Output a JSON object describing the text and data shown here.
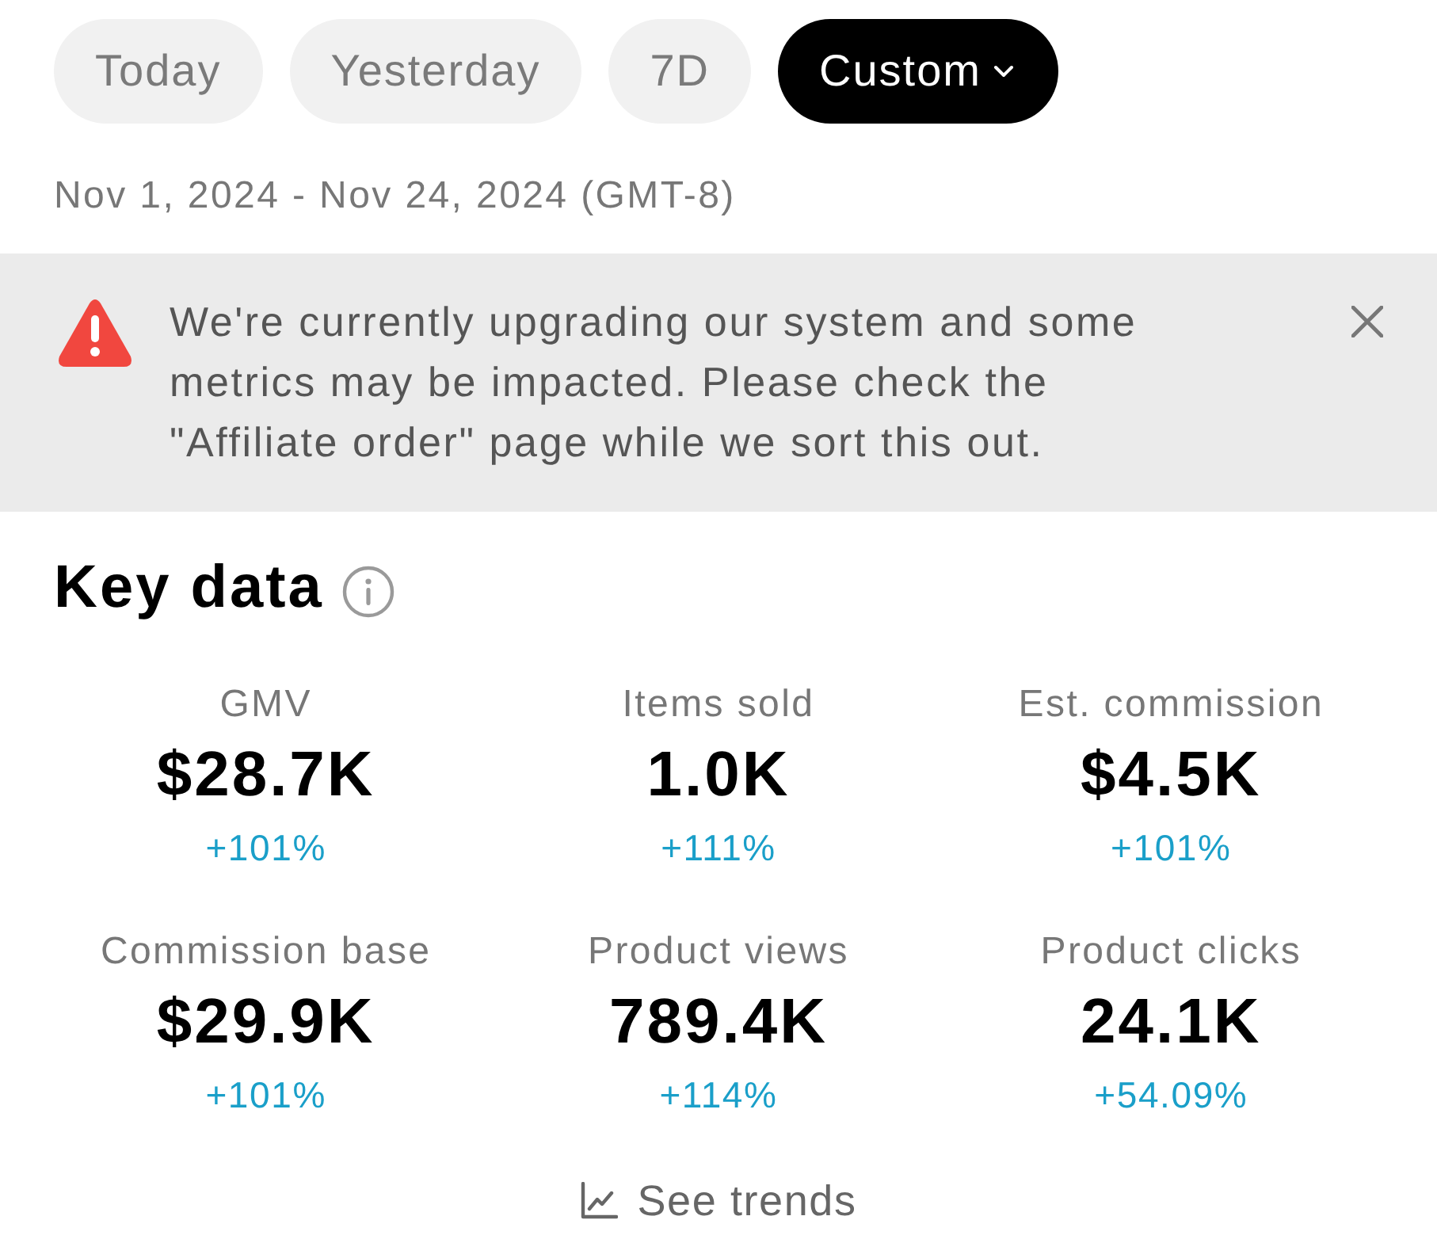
{
  "date_tabs": [
    {
      "label": "Today",
      "selected": false,
      "has_menu": false
    },
    {
      "label": "Yesterday",
      "selected": false,
      "has_menu": false
    },
    {
      "label": "7D",
      "selected": false,
      "has_menu": false
    },
    {
      "label": "Custom",
      "selected": true,
      "has_menu": true
    }
  ],
  "date_range": "Nov 1, 2024 - Nov 24, 2024 (GMT-8)",
  "alert": {
    "message": "We're currently upgrading our system and some metrics may be impacted. Please check the \"Affiliate order\" page while we sort this out."
  },
  "key_data": {
    "title": "Key data",
    "metrics": [
      {
        "label": "GMV",
        "value": "$28.7K",
        "change": "+101%"
      },
      {
        "label": "Items sold",
        "value": "1.0K",
        "change": "+111%"
      },
      {
        "label": "Est. commission",
        "value": "$4.5K",
        "change": "+101%"
      },
      {
        "label": "Commission base",
        "value": "$29.9K",
        "change": "+101%"
      },
      {
        "label": "Product views",
        "value": "789.4K",
        "change": "+114%"
      },
      {
        "label": "Product clicks",
        "value": "24.1K",
        "change": "+54.09%"
      }
    ]
  },
  "see_trends": {
    "label": "See trends"
  }
}
